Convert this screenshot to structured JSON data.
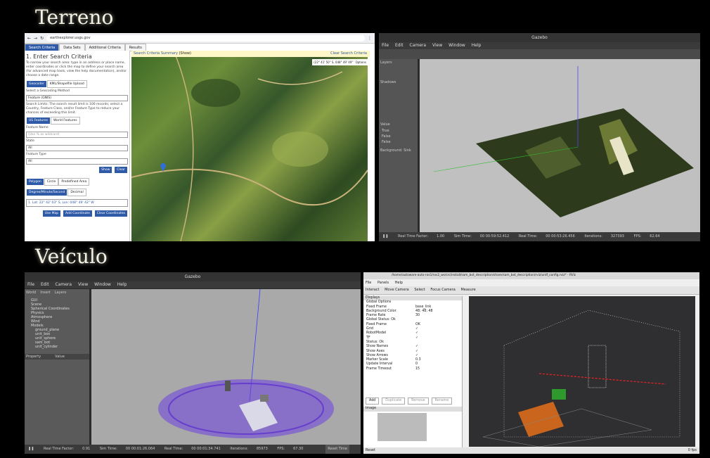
{
  "headings": {
    "terrain": "Terreno",
    "vehicle": "Veículo"
  },
  "earthexplorer": {
    "url": "earthexplorer.usgs.gov",
    "tabs": [
      "Search Criteria",
      "Data Sets",
      "Additional Criteria",
      "Results"
    ],
    "heading": "1. Enter Search Criteria",
    "intro": "To narrow your search area: type in an address or place name, enter coordinates or click the map to define your search area (for advanced map tools, view the help documentation), and/or choose a date range.",
    "subtabs": [
      "Geocoder",
      "KML/Shapefile Upload"
    ],
    "geocoding_label": "Select a Geocoding Method",
    "geocoding_value": "Feature (GNIS)",
    "search_limits": "Search Limits: The search result limit is 100 records; select a Country, Feature Class, and/or Feature Type to reduce your chances of exceeding this limit.",
    "feature_tabs": [
      "US Features",
      "World Features"
    ],
    "feature_name_label": "Feature Name",
    "feature_name_placeholder": "(Use % as wildcard)",
    "state_label": "State",
    "state_value": "All",
    "feature_type_label": "Feature Type",
    "feature_type_value": "All",
    "show_btn": "Show",
    "clear_btn": "Clear",
    "shape_tabs": [
      "Polygon",
      "Circle",
      "Predefined Area"
    ],
    "coord_tabs": [
      "Degree/Minute/Second",
      "Decimal"
    ],
    "coord_entry": "1. Lat: 22° 42' 03\" S, Lon: 048° 49' 42\" W",
    "bottom_buttons": [
      "Use Map",
      "Add Coordinate",
      "Clear Coordinates"
    ],
    "map_header": "Search Criteria Summary",
    "map_header_show": "(Show)",
    "map_clear": "Clear Search Criteria",
    "map_coord": "(22° 41' 50\" S, 048° 49' 49\" W)",
    "map_options": "Options"
  },
  "gazebo_top": {
    "title": "Gazebo",
    "menu": [
      "File",
      "Edit",
      "Camera",
      "View",
      "Window",
      "Help"
    ],
    "side_tabs": [
      "World",
      "Insert",
      "Layers"
    ],
    "side_items": [
      "Shadows",
      "Value",
      "True",
      "False",
      "False",
      "Background: Sink"
    ],
    "status": [
      "Real Time Factor:",
      "1.00",
      "Sim Time:",
      "00 00:59:52.412",
      "Real Time:",
      "00 00:53:26.456",
      "Iterations:",
      "327393",
      "FPS:",
      "62.64"
    ]
  },
  "gazebo_bottom": {
    "title": "Gazebo",
    "menu": [
      "File",
      "Edit",
      "Camera",
      "View",
      "Window",
      "Help"
    ],
    "side_tabs": [
      "World",
      "Insert",
      "Layers"
    ],
    "tree": [
      "GUI",
      "Scene",
      "Spherical Coordinates",
      "Physics",
      "Atmosphere",
      "Wind",
      "Models",
      "ground_plane",
      "unit_box",
      "unit_sphere",
      "sam_bot",
      "unit_cylinder"
    ],
    "prop_headers": [
      "Property",
      "Value"
    ],
    "status": [
      "Real Time Factor:",
      "0.91",
      "Sim Time:",
      "00 00:01:26.064",
      "Real Time:",
      "00 00:01:34.741",
      "Iterations:",
      "85973",
      "FPS:",
      "67.30"
    ],
    "reset_time": "Reset Time"
  },
  "rviz": {
    "title": "/home/autoware-auto-ros1/ros2_ws/src/install/sam_bot_description/share/sam_bot_description/rviz/urdf_config.rviz* - RViz",
    "menu": [
      "File",
      "Panels",
      "Help"
    ],
    "tools": [
      "Interact",
      "Move Camera",
      "Select",
      "Focus Camera",
      "Measure"
    ],
    "displays_title": "Displays",
    "rows": [
      [
        "Global Options",
        ""
      ],
      [
        "Fixed Frame",
        "base_link"
      ],
      [
        "Background Color",
        "48; 48; 48"
      ],
      [
        "Frame Rate",
        "30"
      ],
      [
        "Global Status: Ok",
        ""
      ],
      [
        "Fixed Frame",
        "OK"
      ],
      [
        "Grid",
        "✓"
      ],
      [
        "RobotModel",
        "✓"
      ],
      [
        "TF",
        "✓"
      ],
      [
        "Status: Ok",
        ""
      ],
      [
        "Show Names",
        "✓"
      ],
      [
        "Show Axes",
        "✓"
      ],
      [
        "Show Arrows",
        "✓"
      ],
      [
        "Marker Scale",
        "0.3"
      ],
      [
        "Update Interval",
        "0"
      ],
      [
        "Frame Timeout",
        "15"
      ]
    ],
    "buttons": [
      "Add",
      "Duplicate",
      "Remove",
      "Rename"
    ],
    "image_label": "Image",
    "reset": "Reset",
    "fps": "0 fps"
  }
}
